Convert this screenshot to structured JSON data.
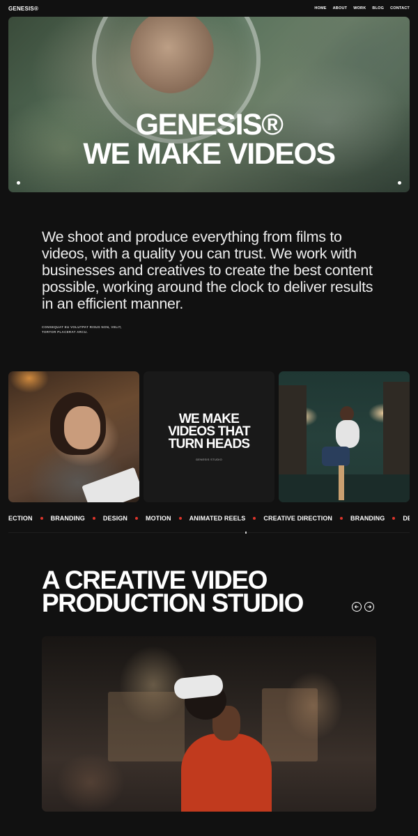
{
  "header": {
    "brand": "GENESIS®",
    "nav": [
      "HOME",
      "ABOUT",
      "WORK",
      "BLOG",
      "CONTACT"
    ]
  },
  "hero": {
    "title_line1": "GENESIS®",
    "title_line2": "WE MAKE VIDEOS"
  },
  "intro": {
    "text": "We shoot and produce everything from films to videos, with a quality you can trust. We work with businesses and creatives to create the best content possible, working around the clock to deliver results in an efficient manner.",
    "small_text": "CONSEQUAT EU VOLUTPAT RISUS NON, VELIT, TORTOR PLACERAT ARCU."
  },
  "feature_card": {
    "title": "WE MAKE VIDEOS THAT TURN HEADS",
    "subtitle": "GENESIS STUDIO"
  },
  "ticker": {
    "items": [
      "ECTION",
      "BRANDING",
      "DESIGN",
      "MOTION",
      "ANIMATED REELS",
      "CREATIVE DIRECTION",
      "BRANDING",
      "DESIGN"
    ],
    "dot_color": "#e0352b"
  },
  "studio": {
    "title_line1": "A CREATIVE VIDEO",
    "title_line2": "PRODUCTION STUDIO",
    "prev_icon": "arrow-left-icon",
    "next_icon": "arrow-right-icon"
  },
  "colors": {
    "background": "#111111",
    "text": "#ffffff",
    "accent": "#e0352b"
  }
}
